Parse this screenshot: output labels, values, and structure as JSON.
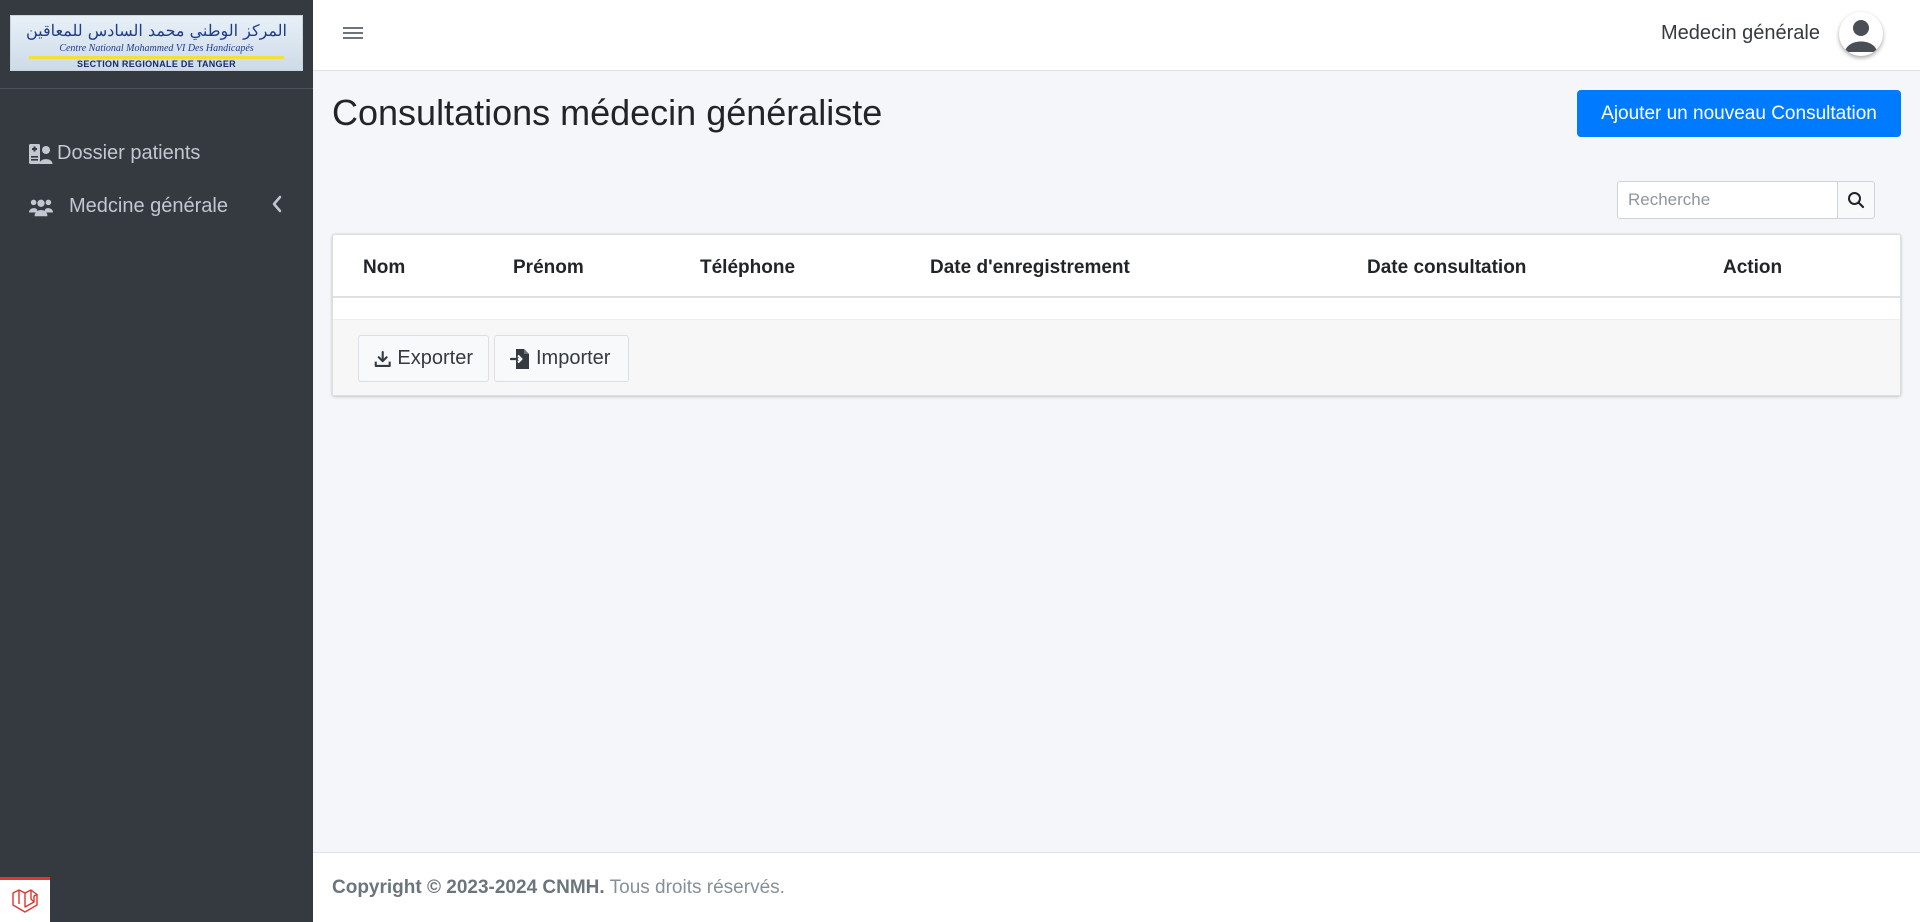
{
  "brand": {
    "logo_arabic": "المركز الوطني محمد السادس للمعاقين",
    "logo_latin": "Centre National Mohammed VI Des Handicapés",
    "logo_section": "SECTION REGIONALE DE TANGER"
  },
  "sidebar": {
    "items": [
      {
        "label": "Dossier patients",
        "icon": "patient-folder-icon"
      },
      {
        "label": "Medcine générale",
        "icon": "users-icon"
      }
    ]
  },
  "topbar": {
    "user_name": "Medecin générale"
  },
  "page": {
    "title": "Consultations médecin généraliste",
    "add_button": "Ajouter un nouveau Consultation"
  },
  "search": {
    "placeholder": "Recherche"
  },
  "table": {
    "columns": [
      "Nom",
      "Prénom",
      "Téléphone",
      "Date d'enregistrement",
      "Date consultation",
      "Action"
    ],
    "rows": []
  },
  "actions": {
    "export_label": "Exporter",
    "import_label": "Importer"
  },
  "footer": {
    "copyright": "Copyright © 2023-2024 CNMH.",
    "rights": "Tous droits réservés."
  },
  "colors": {
    "sidebar_bg": "#343a40",
    "primary": "#007bff",
    "laravel_red": "#e3342f"
  }
}
